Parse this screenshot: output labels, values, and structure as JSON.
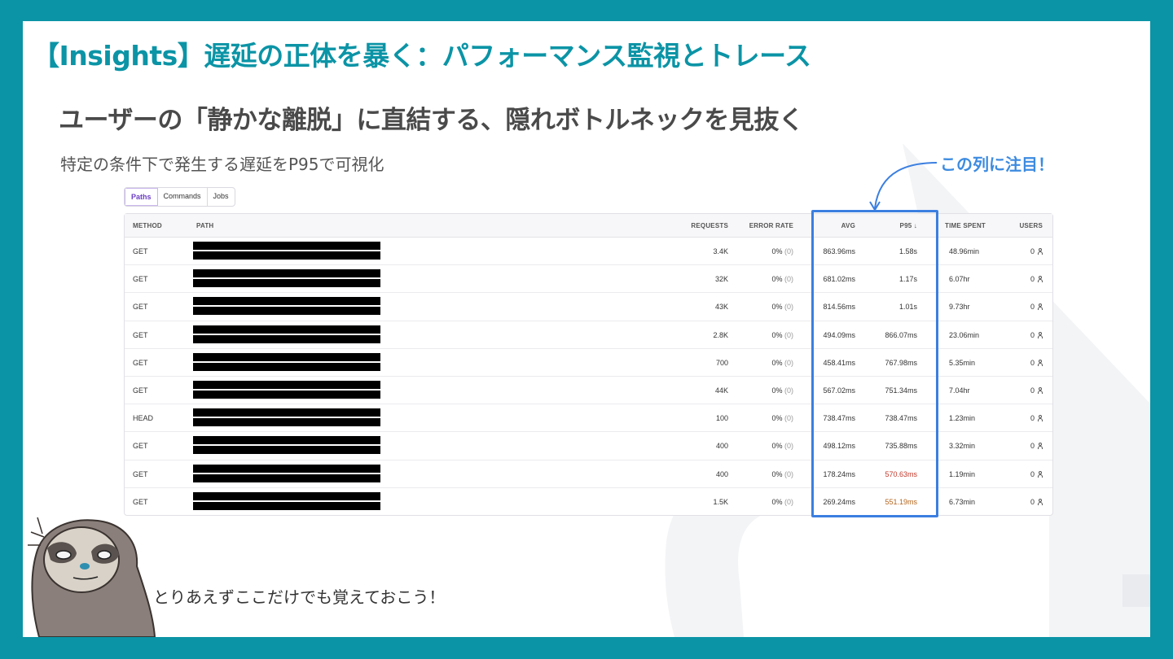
{
  "slide": {
    "title": "【Insights】遅延の正体を暴く：パフォーマンス監視とトレース",
    "subtitle": "ユーザーの「静かな離脱」に直結する、隠れボトルネックを見抜く",
    "caption": "特定の条件下で発生する遅延をP95で可視化",
    "callout": "この列に注目！",
    "footer_note": "とりあえずここだけでも覚えておこう！"
  },
  "colors": {
    "frame": "#0b94a6",
    "title": "#0b94a6",
    "highlight": "#3b7fe0",
    "callout": "#3d8be0",
    "p95_warning": "#c0392b"
  },
  "tabs": [
    {
      "label": "Paths",
      "active": true
    },
    {
      "label": "Commands",
      "active": false
    },
    {
      "label": "Jobs",
      "active": false
    }
  ],
  "table": {
    "headers": {
      "method": "METHOD",
      "path": "PATH",
      "requests": "REQUESTS",
      "error_rate": "ERROR RATE",
      "avg": "AVG",
      "p95": "P95 ↓",
      "time_spent": "TIME SPENT",
      "users": "USERS"
    },
    "rows": [
      {
        "method": "GET",
        "requests": "3.4K",
        "error_rate": "0%",
        "error_count": "(0)",
        "avg": "863.96ms",
        "p95": "1.58s",
        "time_spent": "48.96min",
        "users": "0"
      },
      {
        "method": "GET",
        "requests": "32K",
        "error_rate": "0%",
        "error_count": "(0)",
        "avg": "681.02ms",
        "p95": "1.17s",
        "time_spent": "6.07hr",
        "users": "0"
      },
      {
        "method": "GET",
        "requests": "43K",
        "error_rate": "0%",
        "error_count": "(0)",
        "avg": "814.56ms",
        "p95": "1.01s",
        "time_spent": "9.73hr",
        "users": "0"
      },
      {
        "method": "GET",
        "requests": "2.8K",
        "error_rate": "0%",
        "error_count": "(0)",
        "avg": "494.09ms",
        "p95": "866.07ms",
        "time_spent": "23.06min",
        "users": "0"
      },
      {
        "method": "GET",
        "requests": "700",
        "error_rate": "0%",
        "error_count": "(0)",
        "avg": "458.41ms",
        "p95": "767.98ms",
        "time_spent": "5.35min",
        "users": "0"
      },
      {
        "method": "GET",
        "requests": "44K",
        "error_rate": "0%",
        "error_count": "(0)",
        "avg": "567.02ms",
        "p95": "751.34ms",
        "time_spent": "7.04hr",
        "users": "0"
      },
      {
        "method": "HEAD",
        "requests": "100",
        "error_rate": "0%",
        "error_count": "(0)",
        "avg": "738.47ms",
        "p95": "738.47ms",
        "time_spent": "1.23min",
        "users": "0"
      },
      {
        "method": "GET",
        "requests": "400",
        "error_rate": "0%",
        "error_count": "(0)",
        "avg": "498.12ms",
        "p95": "735.88ms",
        "time_spent": "3.32min",
        "users": "0"
      },
      {
        "method": "GET",
        "requests": "400",
        "error_rate": "0%",
        "error_count": "(0)",
        "avg": "178.24ms",
        "p95": "570.63ms",
        "time_spent": "1.19min",
        "users": "0",
        "p95_status": "warn"
      },
      {
        "method": "GET",
        "requests": "1.5K",
        "error_rate": "0%",
        "error_count": "(0)",
        "avg": "269.24ms",
        "p95": "551.19ms",
        "time_spent": "6.73min",
        "users": "0",
        "p95_status": "warn2"
      }
    ]
  },
  "icons": {
    "users": "user-icon",
    "callout_pointer": "curved-arrow-icon",
    "mascot": "sloth-mascot-icon"
  }
}
